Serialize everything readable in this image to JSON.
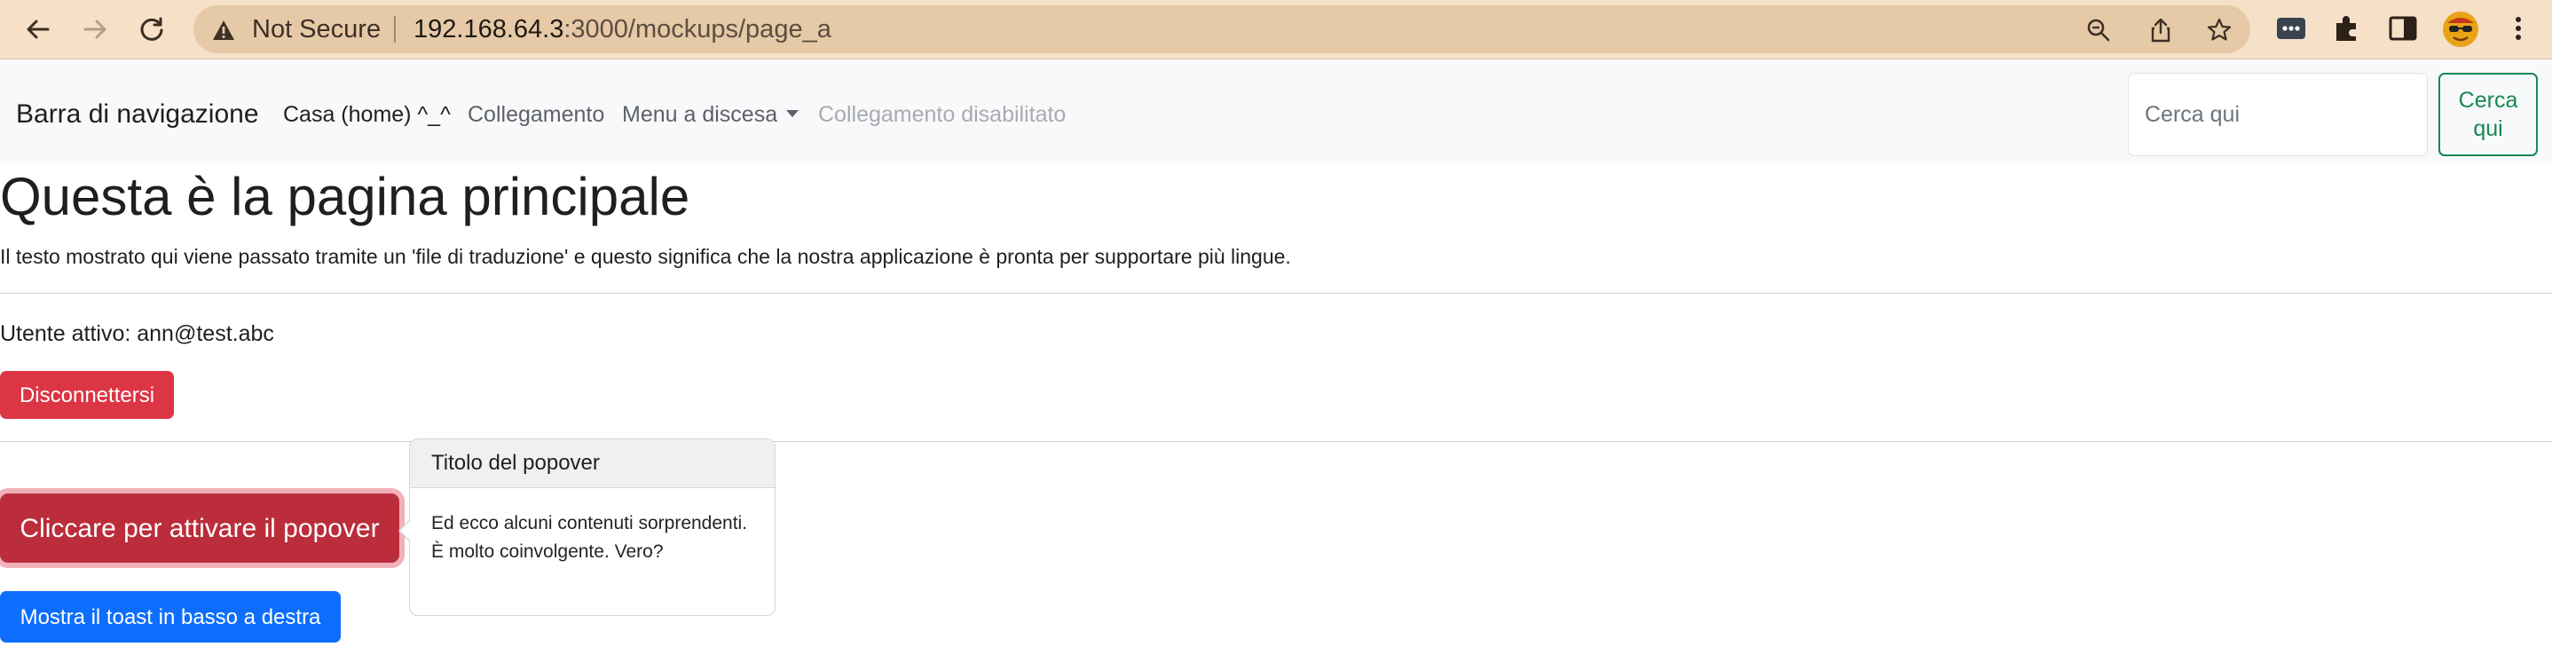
{
  "browser": {
    "security_label": "Not Secure",
    "url_host": "192.168.64.3",
    "url_rest": ":3000/mockups/page_a",
    "icons": {
      "back": "arrow-left-icon",
      "forward": "arrow-right-icon",
      "reload": "reload-icon",
      "warning": "warning-triangle-icon",
      "zoom": "zoom-icon",
      "share": "share-icon",
      "bookmark": "star-icon",
      "extension1": "more-dots-extension-icon",
      "extensions": "puzzle-icon",
      "sidepanel": "side-panel-icon",
      "profile": "avatar-icon",
      "menu": "kebab-menu-icon"
    },
    "colors": {
      "frame": "#f6e0c8",
      "omnibox": "#e6c9a6"
    }
  },
  "navbar": {
    "brand": "Barra di navigazione",
    "links": [
      {
        "label": "Casa (home) ^_^",
        "state": "active"
      },
      {
        "label": "Collegamento",
        "state": "normal"
      },
      {
        "label": "Menu a discesa",
        "state": "dropdown"
      },
      {
        "label": "Collegamento disabilitato",
        "state": "disabled"
      }
    ],
    "search_placeholder": "Cerca qui",
    "search_button_line1": "Cerca",
    "search_button_line2": "qui"
  },
  "main": {
    "title": "Questa è la pagina principale",
    "lead": "Il testo mostrato qui viene passato tramite un 'file di traduzione' e questo significa che la nostra applicazione è pronta per supportare più lingue.",
    "user_line": "Utente attivo: ann@test.abc",
    "logout_button": "Disconnettersi",
    "popover_button": "Cliccare per attivare il popover",
    "toast_button": "Mostra il toast in basso a destra"
  },
  "popover": {
    "title": "Titolo del popover",
    "body": "Ed ecco alcuni contenuti sorprendenti. È molto coinvolgente. Vero?"
  },
  "colors": {
    "danger": "#dc3545",
    "danger_active": "#bb2d3b",
    "primary": "#0d6efd",
    "success": "#198754"
  }
}
